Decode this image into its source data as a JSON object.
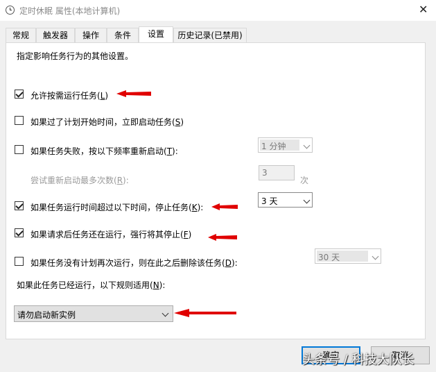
{
  "window": {
    "title": "定时休眠 属性(本地计算机)",
    "close": "✕"
  },
  "tabs": [
    {
      "label": "常规"
    },
    {
      "label": "触发器"
    },
    {
      "label": "操作"
    },
    {
      "label": "条件"
    },
    {
      "label": "设置",
      "active": true
    },
    {
      "label": "历史记录(已禁用)"
    }
  ],
  "settings": {
    "description": "指定影响任务行为的其他设置。",
    "allow_on_demand": {
      "text": "允许按需运行任务(",
      "key": "L",
      "tail": ")",
      "checked": true
    },
    "run_if_missed": {
      "text": "如果过了计划开始时间，立即启动任务(",
      "key": "S",
      "tail": ")",
      "checked": false
    },
    "restart_on_failure": {
      "text": "如果任务失败，按以下频率重新启动(",
      "key": "T",
      "tail": "):",
      "checked": false,
      "interval": "1 分钟"
    },
    "restart_attempts": {
      "text": "尝试重新启动最多次数(",
      "key": "R",
      "tail": "):",
      "value": "3",
      "unit": "次"
    },
    "stop_if_runs_longer": {
      "text": "如果任务运行时间超过以下时间，停止任务(",
      "key": "K",
      "tail": "):",
      "checked": true,
      "duration": "3 天"
    },
    "force_stop": {
      "text": "如果请求后任务还在运行，强行将其停止(",
      "key": "F",
      "tail": ")",
      "checked": true
    },
    "delete_if_not_scheduled": {
      "text": "如果任务没有计划再次运行，则在此之后删除该任务(",
      "key": "D",
      "tail": "):",
      "checked": false,
      "after": "30 天"
    },
    "running_rule": {
      "text": "如果此任务已经运行，以下规则适用(",
      "key": "N",
      "tail": "):",
      "value": "请勿启动新实例"
    }
  },
  "buttons": {
    "ok": "确定",
    "cancel": "取消"
  },
  "annotation_color": "#e00000",
  "watermark": "头条号 / 科技大队长"
}
